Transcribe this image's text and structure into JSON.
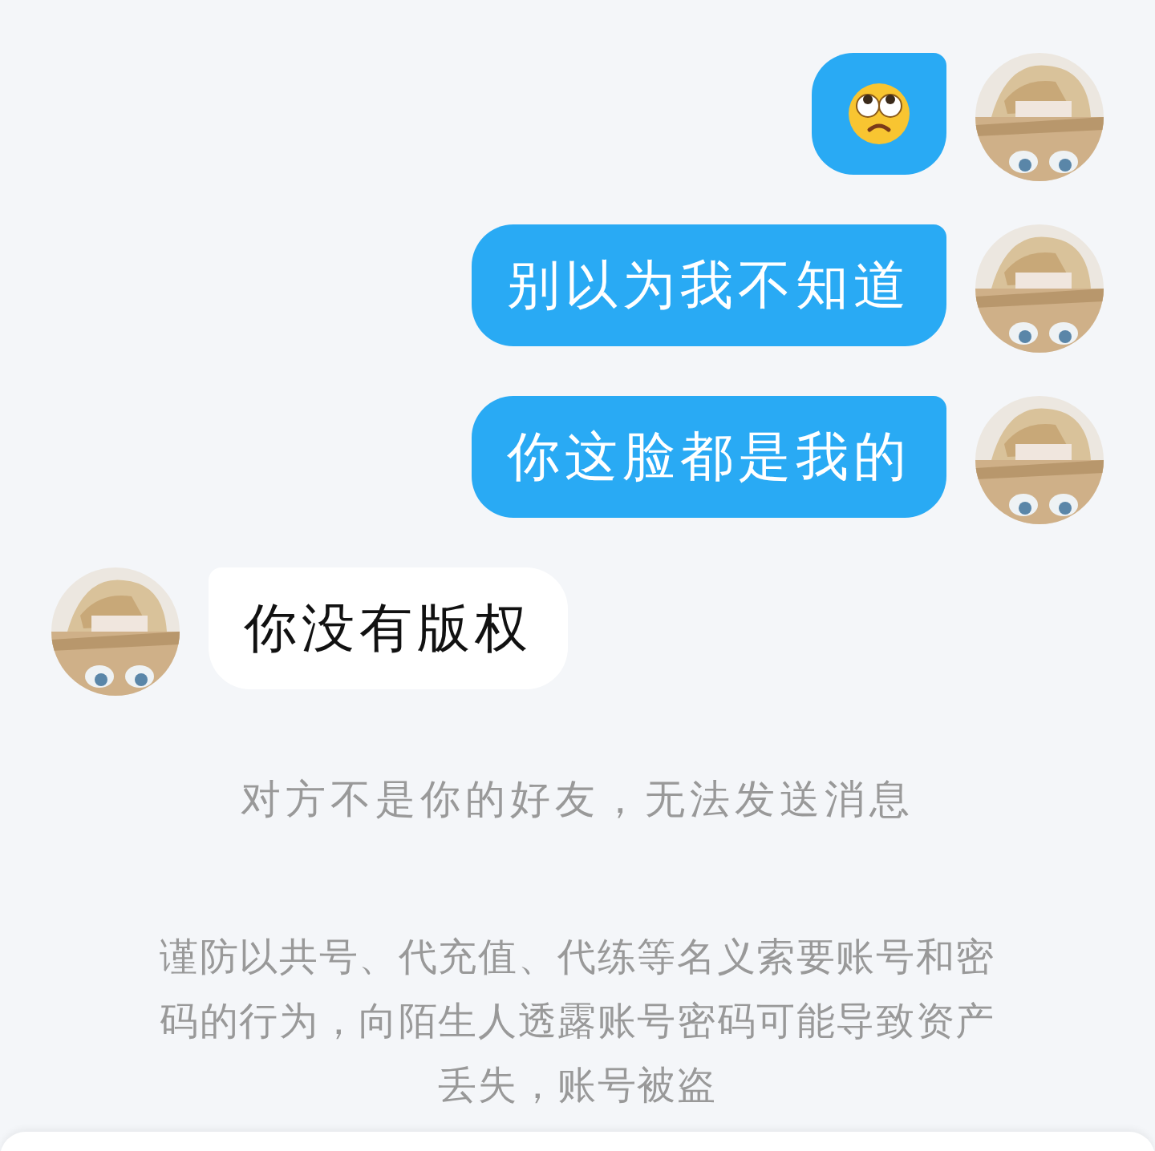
{
  "messages": [
    {
      "outgoing": true,
      "kind": "emoji"
    },
    {
      "outgoing": true,
      "kind": "text",
      "text": "别以为我不知道"
    },
    {
      "outgoing": true,
      "kind": "text",
      "text": "你这脸都是我的"
    },
    {
      "outgoing": false,
      "kind": "text",
      "text": "你没有版权"
    }
  ],
  "notice": "对方不是你的好友，无法发送消息",
  "warning": "谨防以共号、代充值、代练等名义索要账号和密码的行为，向陌生人透露账号密码可能导致资产丢失，账号被盗"
}
